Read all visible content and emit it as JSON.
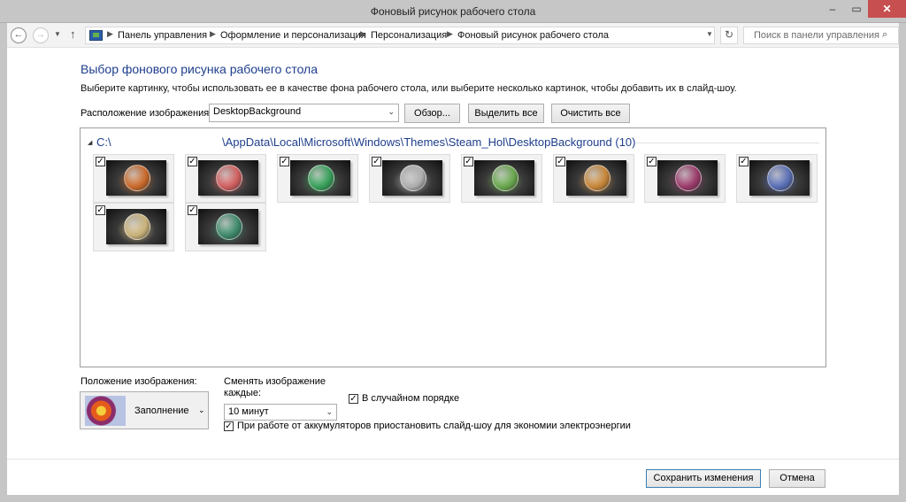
{
  "window": {
    "title": "Фоновый рисунок рабочего стола",
    "minimize": "–",
    "maximize": "▭",
    "close": "✕"
  },
  "nav": {
    "back": "←",
    "forward": "→",
    "history": "▼",
    "up": "↑",
    "breadcrumb": [
      "Панель управления",
      "Оформление и персонализация",
      "Персонализация",
      "Фоновый рисунок рабочего стола"
    ],
    "separator": "▶",
    "dropdown": "▼",
    "refresh": "↻",
    "search_placeholder": "Поиск в панели управления",
    "search_icon": "⌕"
  },
  "main": {
    "heading": "Выбор фонового рисунка рабочего стола",
    "description": "Выберите картинку, чтобы использовать ее в качестве фона рабочего стола, или выберите несколько картинок, чтобы добавить их в слайд-шоу.",
    "location_label": "Расположение изображения:",
    "location_value": "DesktopBackground",
    "browse": "Обзор...",
    "select_all": "Выделить все",
    "clear_all": "Очистить все"
  },
  "gallery": {
    "collapse_icon": "◢",
    "drive": "C:\\",
    "path": "\\AppData\\Local\\Microsoft\\Windows\\Themes\\Steam_Hol\\DesktopBackground (10)",
    "checkmark": "✓",
    "images": [
      {
        "checked": true,
        "accent": "#c96a2b"
      },
      {
        "checked": true,
        "accent": "#d06060"
      },
      {
        "checked": true,
        "accent": "#38a05a"
      },
      {
        "checked": true,
        "accent": "#b0b0b0"
      },
      {
        "checked": true,
        "accent": "#6aa84f"
      },
      {
        "checked": true,
        "accent": "#c7873a"
      },
      {
        "checked": true,
        "accent": "#9b3c6b"
      },
      {
        "checked": true,
        "accent": "#5a6fb5"
      },
      {
        "checked": true,
        "accent": "#c9b27a"
      },
      {
        "checked": true,
        "accent": "#3f8a6c"
      }
    ]
  },
  "options": {
    "position_label": "Положение изображения:",
    "position_value": "Заполнение",
    "change_label": "Сменять изображение каждые:",
    "interval_value": "10 минут",
    "shuffle_label": "В случайном порядке",
    "shuffle_checked": true,
    "battery_label": "При работе от аккумуляторов приостановить слайд-шоу для экономии электроэнергии",
    "battery_checked": true,
    "dropdown_arrow": "⌄"
  },
  "footer": {
    "save": "Сохранить изменения",
    "cancel": "Отмена"
  },
  "colors": {
    "heading": "#1e3e8c",
    "close_button": "#c74f4f",
    "default_button_border": "#3c7fb1"
  }
}
